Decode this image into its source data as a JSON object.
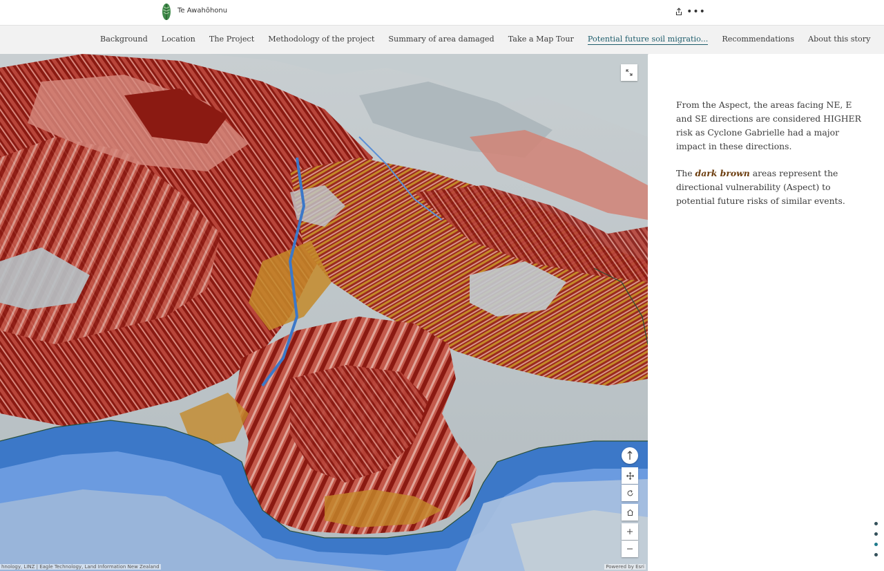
{
  "header": {
    "site_title": "Te Awahōhonu",
    "share_icon": "share-icon",
    "more_icon": "more-icon",
    "more_label": "•••"
  },
  "nav": {
    "items": [
      {
        "label": "Background"
      },
      {
        "label": "Location"
      },
      {
        "label": "The Project"
      },
      {
        "label": "Methodology of the project"
      },
      {
        "label": "Summary of area damaged"
      },
      {
        "label": "Take a Map Tour"
      },
      {
        "label": "Potential future soil migratio..."
      },
      {
        "label": "Recommendations"
      },
      {
        "label": "About this story"
      }
    ],
    "active_index": 6
  },
  "map": {
    "attribution_left": "hnology, LINZ | Eagle Technology, Land Information New Zealand",
    "attribution_right": "Powered by Esri",
    "controls": [
      "expand-icon",
      "compass-icon",
      "pan-icon",
      "rotate-icon",
      "home-icon",
      "zoom-in-icon",
      "zoom-out-icon"
    ],
    "colors": {
      "dark_brown": "#8b1a12",
      "salmon": "#d98a80",
      "ochre": "#c48a2a",
      "blue": "#3c78c8",
      "terrain_gray": "#b9c2c6"
    }
  },
  "panel": {
    "para1": "From the Aspect, the areas facing NE, E and SE directions are considered HIGHER risk as Cyclone Gabrielle had a major impact in these directions.",
    "para2_pre": "The ",
    "para2_highlight": "dark brown",
    "para2_post": " areas represent the directional vulnerability (Aspect) to potential future risks of similar events.",
    "highlight_color": "#6b3c0d"
  },
  "progress_dots": {
    "count": 4,
    "active_index": 2
  }
}
